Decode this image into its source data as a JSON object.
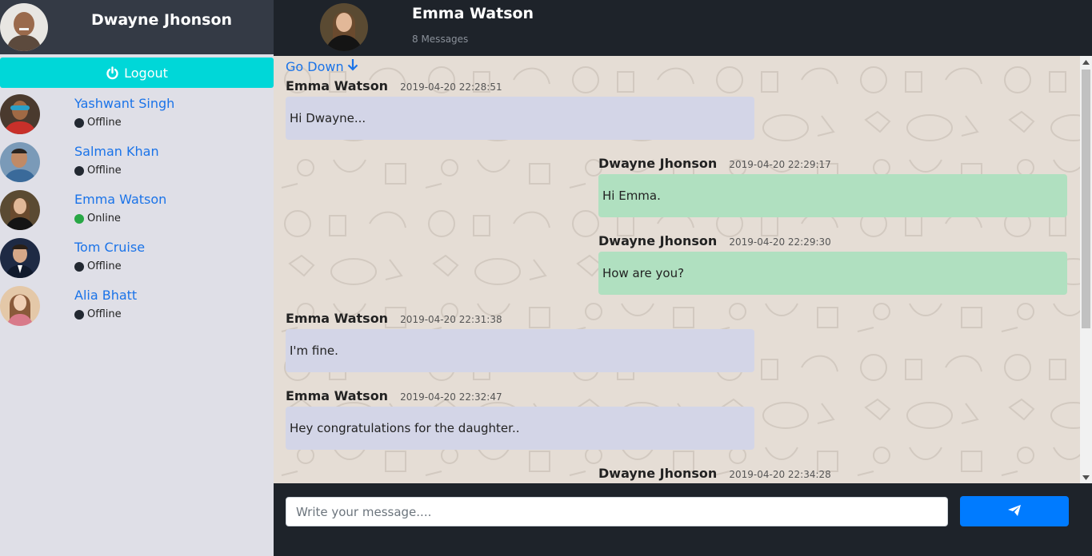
{
  "current_user": {
    "name": "Dwayne Jhonson"
  },
  "logout_label": "Logout",
  "contacts": [
    {
      "name": "Yashwant Singh",
      "status": "Offline",
      "status_color": "#222831"
    },
    {
      "name": "Salman Khan",
      "status": "Offline",
      "status_color": "#222831"
    },
    {
      "name": "Emma Watson",
      "status": "Online",
      "status_color": "#28a745"
    },
    {
      "name": "Tom Cruise",
      "status": "Offline",
      "status_color": "#222831"
    },
    {
      "name": "Alia Bhatt",
      "status": "Offline",
      "status_color": "#222831"
    }
  ],
  "chat": {
    "peer_name": "Emma Watson",
    "message_count": "8 Messages",
    "go_down_label": "Go Down",
    "messages": [
      {
        "sender": "Emma Watson",
        "time": "2019-04-20 22:28:51",
        "text": "Hi Dwayne...",
        "direction": "in"
      },
      {
        "sender": "Dwayne Jhonson",
        "time": "2019-04-20 22:29:17",
        "text": "Hi Emma.",
        "direction": "out"
      },
      {
        "sender": "Dwayne Jhonson",
        "time": "2019-04-20 22:29:30",
        "text": "How are you?",
        "direction": "out"
      },
      {
        "sender": "Emma Watson",
        "time": "2019-04-20 22:31:38",
        "text": "I'm fine.",
        "direction": "in"
      },
      {
        "sender": "Emma Watson",
        "time": "2019-04-20 22:32:47",
        "text": "Hey congratulations for the daughter..",
        "direction": "in"
      },
      {
        "sender": "Dwayne Jhonson",
        "time": "2019-04-20 22:34:28",
        "text": "",
        "direction": "out"
      }
    ]
  },
  "composer": {
    "placeholder": "Write your message....",
    "value": ""
  },
  "colors": {
    "accent_cyan": "#00d7d8",
    "send_blue": "#007bff",
    "link_blue": "#1a73e8",
    "incoming_bubble": "#d3d5e7",
    "outgoing_bubble": "#b0e0c0"
  }
}
